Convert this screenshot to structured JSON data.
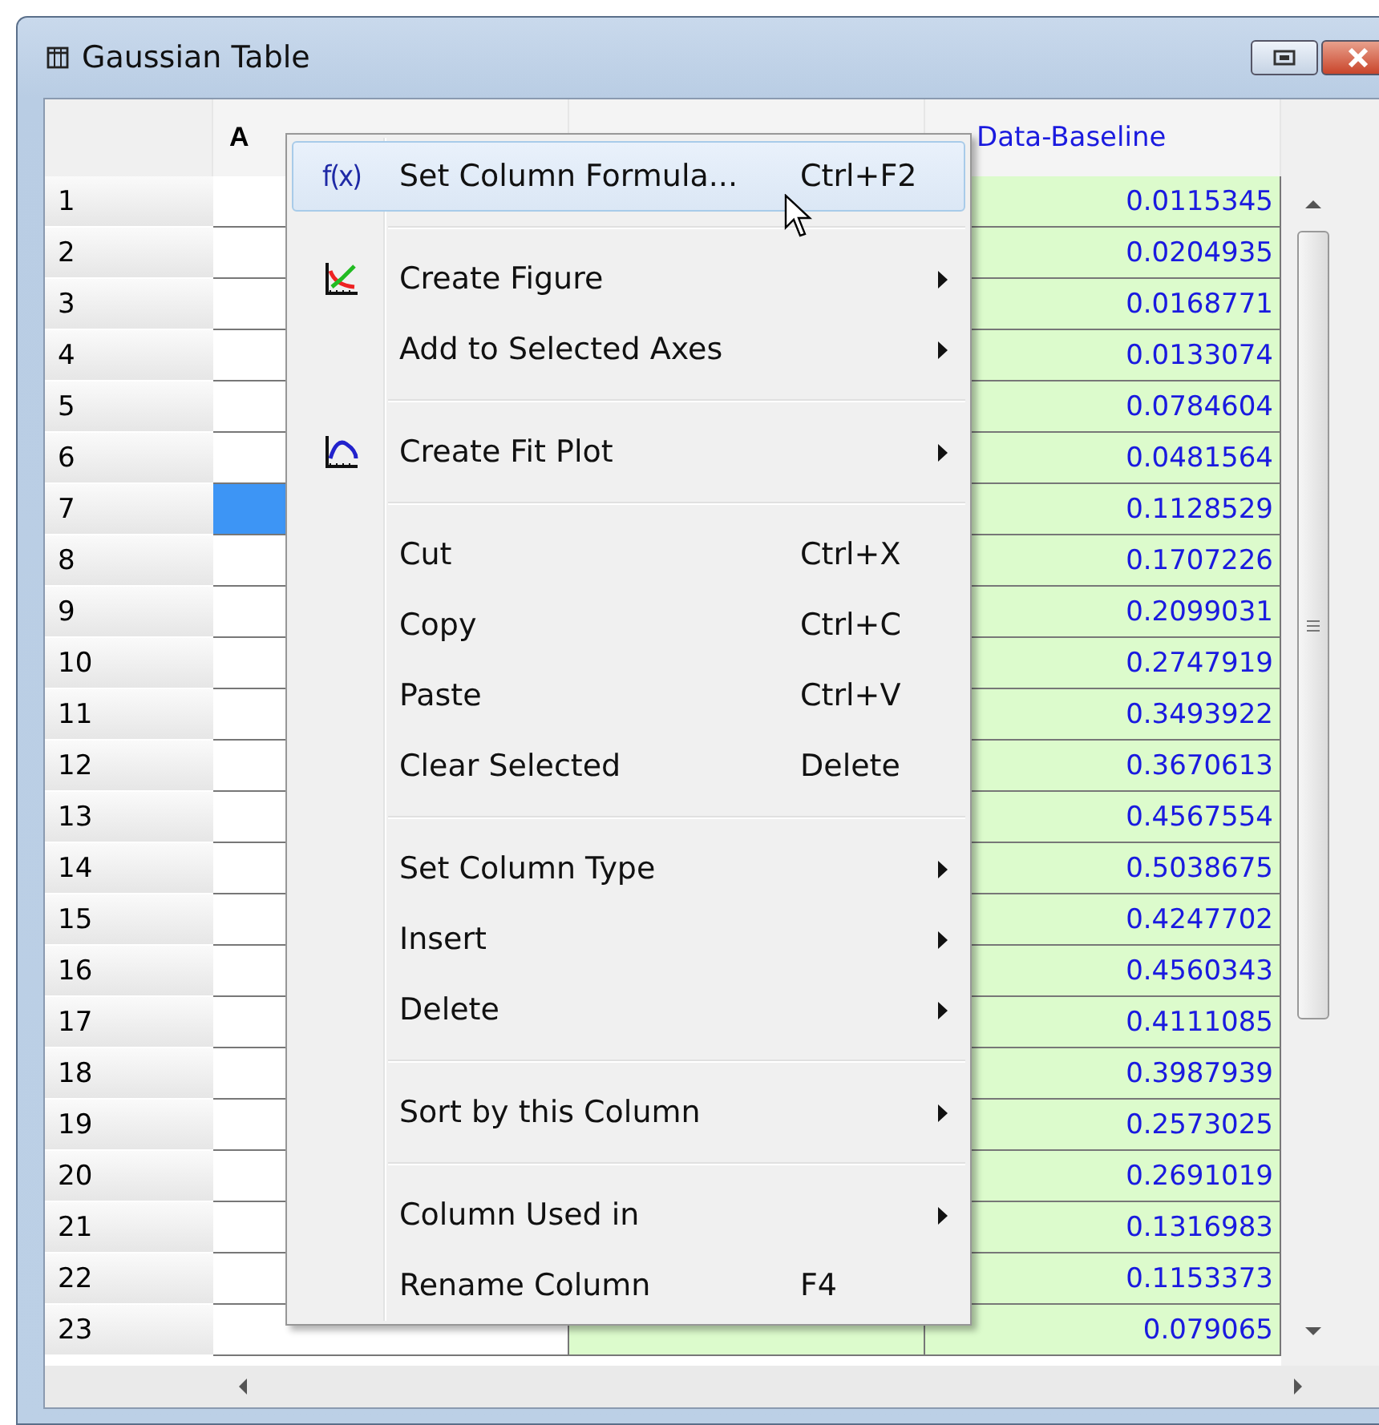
{
  "window": {
    "title": "Gaussian Table"
  },
  "table": {
    "column_a_header": "A",
    "column_c_header": "Data-Baseline",
    "rows": [
      {
        "number": "1",
        "value_c": "0.0115345",
        "selected": false
      },
      {
        "number": "2",
        "value_c": "0.0204935",
        "selected": false
      },
      {
        "number": "3",
        "value_c": "0.0168771",
        "selected": false
      },
      {
        "number": "4",
        "value_c": "0.0133074",
        "selected": false
      },
      {
        "number": "5",
        "value_c": "0.0784604",
        "selected": false
      },
      {
        "number": "6",
        "value_c": "0.0481564",
        "selected": false
      },
      {
        "number": "7",
        "value_c": "0.1128529",
        "selected": true
      },
      {
        "number": "8",
        "value_c": "0.1707226",
        "selected": false
      },
      {
        "number": "9",
        "value_c": "0.2099031",
        "selected": false
      },
      {
        "number": "10",
        "value_c": "0.2747919",
        "selected": false
      },
      {
        "number": "11",
        "value_c": "0.3493922",
        "selected": false
      },
      {
        "number": "12",
        "value_c": "0.3670613",
        "selected": false
      },
      {
        "number": "13",
        "value_c": "0.4567554",
        "selected": false
      },
      {
        "number": "14",
        "value_c": "0.5038675",
        "selected": false
      },
      {
        "number": "15",
        "value_c": "0.4247702",
        "selected": false
      },
      {
        "number": "16",
        "value_c": "0.4560343",
        "selected": false
      },
      {
        "number": "17",
        "value_c": "0.4111085",
        "selected": false
      },
      {
        "number": "18",
        "value_c": "0.3987939",
        "selected": false
      },
      {
        "number": "19",
        "value_c": "0.2573025",
        "selected": false
      },
      {
        "number": "20",
        "value_c": "0.2691019",
        "selected": false
      },
      {
        "number": "21",
        "value_c": "0.1316983",
        "selected": false
      },
      {
        "number": "22",
        "value_c": "0.1153373",
        "selected": false
      },
      {
        "number": "23",
        "value_c": "0.079065",
        "selected": false
      }
    ]
  },
  "context_menu": {
    "groups": [
      [
        {
          "label": "Set Column Formula...",
          "shortcut": "Ctrl+F2",
          "kind": "formula",
          "icon_text": "f(x)",
          "submenu": false,
          "highlighted": true
        }
      ],
      [
        {
          "label": "Create Figure",
          "kind": "figure",
          "submenu": true,
          "highlighted": false
        },
        {
          "label": "Add to Selected Axes",
          "submenu": true,
          "highlighted": false
        }
      ],
      [
        {
          "label": "Create Fit Plot",
          "kind": "fit",
          "submenu": true,
          "highlighted": false
        }
      ],
      [
        {
          "label": "Cut",
          "shortcut": "Ctrl+X",
          "submenu": false,
          "highlighted": false
        },
        {
          "label": "Copy",
          "shortcut": "Ctrl+C",
          "submenu": false,
          "highlighted": false
        },
        {
          "label": "Paste",
          "shortcut": "Ctrl+V",
          "submenu": false,
          "highlighted": false
        },
        {
          "label": "Clear Selected",
          "shortcut": "Delete",
          "submenu": false,
          "highlighted": false
        }
      ],
      [
        {
          "label": "Set Column Type",
          "submenu": true,
          "highlighted": false
        },
        {
          "label": "Insert",
          "submenu": true,
          "highlighted": false
        },
        {
          "label": "Delete",
          "submenu": true,
          "highlighted": false
        }
      ],
      [
        {
          "label": "Sort by this Column",
          "submenu": true,
          "highlighted": false
        }
      ],
      [
        {
          "label": "Column Used in",
          "submenu": true,
          "highlighted": false
        },
        {
          "label": "Rename Column",
          "shortcut": "F4",
          "submenu": false,
          "highlighted": false
        }
      ]
    ]
  }
}
